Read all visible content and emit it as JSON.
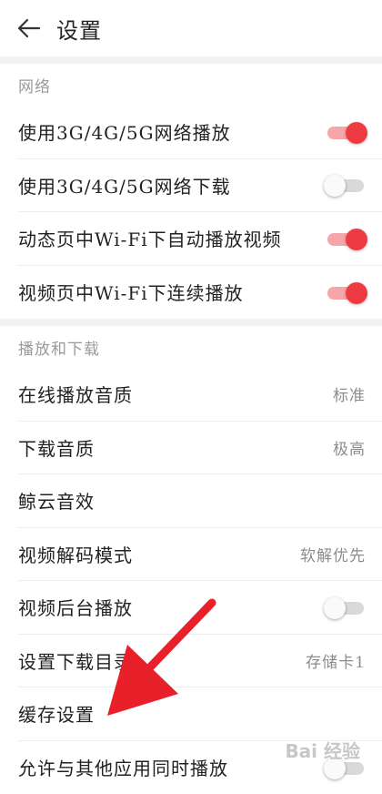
{
  "header": {
    "title": "设置"
  },
  "sections": {
    "network": {
      "title": "网络",
      "items": [
        {
          "label": "使用3G/4G/5G网络播放",
          "toggle": "on"
        },
        {
          "label": "使用3G/4G/5G网络下载",
          "toggle": "off"
        },
        {
          "label": "动态页中Wi-Fi下自动播放视频",
          "toggle": "on"
        },
        {
          "label": "视频页中Wi-Fi下连续播放",
          "toggle": "on"
        }
      ]
    },
    "playback": {
      "title": "播放和下载",
      "items": [
        {
          "label": "在线播放音质",
          "value": "标准"
        },
        {
          "label": "下载音质",
          "value": "极高"
        },
        {
          "label": "鲸云音效",
          "value": ""
        },
        {
          "label": "视频解码模式",
          "value": "软解优先"
        },
        {
          "label": "视频后台播放",
          "toggle": "off"
        },
        {
          "label": "设置下载目录",
          "value": "存储卡1"
        },
        {
          "label": "缓存设置",
          "value": ""
        },
        {
          "label": "允许与其他应用同时播放",
          "toggle": "off"
        }
      ]
    }
  },
  "colors": {
    "accent": "#ee3b41",
    "arrow": "#e8202a"
  },
  "watermark": "Bai 经验"
}
